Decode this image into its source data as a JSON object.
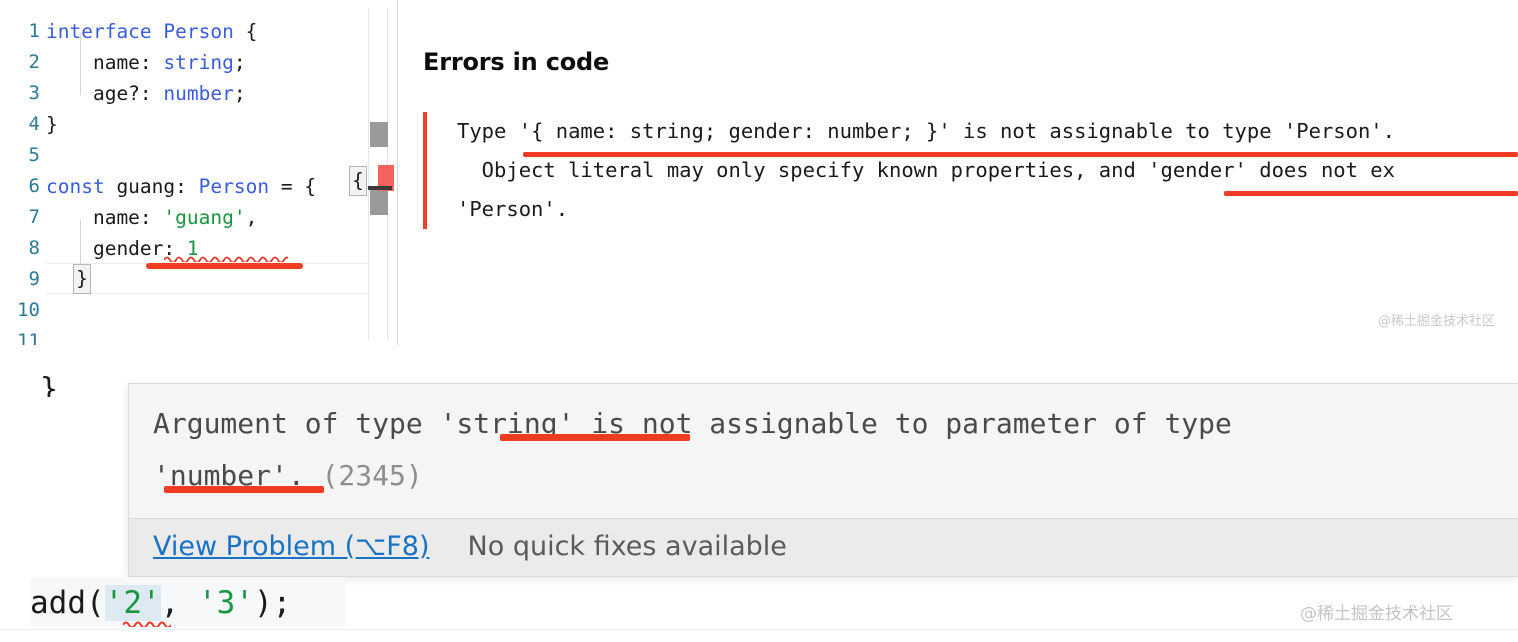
{
  "editor": {
    "line_numbers": [
      "1",
      "2",
      "3",
      "4",
      "5",
      "6",
      "7",
      "8",
      "9",
      "10",
      "11"
    ],
    "lines": [
      {
        "n": 1,
        "tokens": [
          {
            "t": "interface",
            "c": "kw"
          },
          {
            "t": " ",
            "c": "pun"
          },
          {
            "t": "Person",
            "c": "typ"
          },
          {
            "t": " {",
            "c": "pun"
          }
        ]
      },
      {
        "n": 2,
        "tokens": [
          {
            "t": "    name: ",
            "c": "pun"
          },
          {
            "t": "string",
            "c": "typ"
          },
          {
            "t": ";",
            "c": "pun"
          }
        ]
      },
      {
        "n": 3,
        "tokens": [
          {
            "t": "    age?: ",
            "c": "pun"
          },
          {
            "t": "number",
            "c": "typ"
          },
          {
            "t": ";",
            "c": "pun"
          }
        ]
      },
      {
        "n": 4,
        "tokens": [
          {
            "t": "}",
            "c": "pun"
          }
        ]
      },
      {
        "n": 5,
        "tokens": []
      },
      {
        "n": 6,
        "tokens": [
          {
            "t": "const",
            "c": "kw"
          },
          {
            "t": " guang: ",
            "c": "pun"
          },
          {
            "t": "Person",
            "c": "typ"
          },
          {
            "t": " = {",
            "c": "pun"
          }
        ]
      },
      {
        "n": 7,
        "tokens": [
          {
            "t": "    name: ",
            "c": "pun"
          },
          {
            "t": "'guang'",
            "c": "str"
          },
          {
            "t": ",",
            "c": "pun"
          }
        ]
      },
      {
        "n": 8,
        "tokens": [
          {
            "t": "    gender: ",
            "c": "pun"
          },
          {
            "t": "1",
            "c": "num"
          }
        ]
      },
      {
        "n": 9,
        "tokens": [
          {
            "t": "}",
            "c": "pun"
          }
        ]
      },
      {
        "n": 10,
        "tokens": []
      }
    ],
    "bracket_open": "{",
    "bracket_close": "}"
  },
  "errors_panel": {
    "title": "Errors in code",
    "message_lines": [
      "Type '{ name: string; gender: number; }' is not assignable to type 'Person'.",
      "  Object literal may only specify known properties, and 'gender' does not ex",
      "'Person'."
    ]
  },
  "tooltip": {
    "message_line1": "Argument of type 'string' is not assignable to parameter of type",
    "message_line2_text": "'number'. ",
    "message_line2_code": "(2345)",
    "view_problem_label": "View Problem (⌥F8)",
    "no_fixes_label": "No quick fixes available"
  },
  "bottom_code": {
    "prefix": "add(",
    "arg1": "'2'",
    "separator": ", ",
    "arg2": "'3'",
    "suffix": ");"
  },
  "stray_glyph": "}",
  "watermark": {
    "top": "@稀土掘金技术社区",
    "bottom": "@稀土掘金技术社区"
  },
  "colors": {
    "keyword": "#3b5ddb",
    "type": "#3b5ddb",
    "string": "#1a9641",
    "annotation_red": "#ef3b21",
    "error_bar": "#e8452c",
    "link_blue": "#1a72c4",
    "line_number": "#2b7a95",
    "error_marker": "#f4645a"
  }
}
